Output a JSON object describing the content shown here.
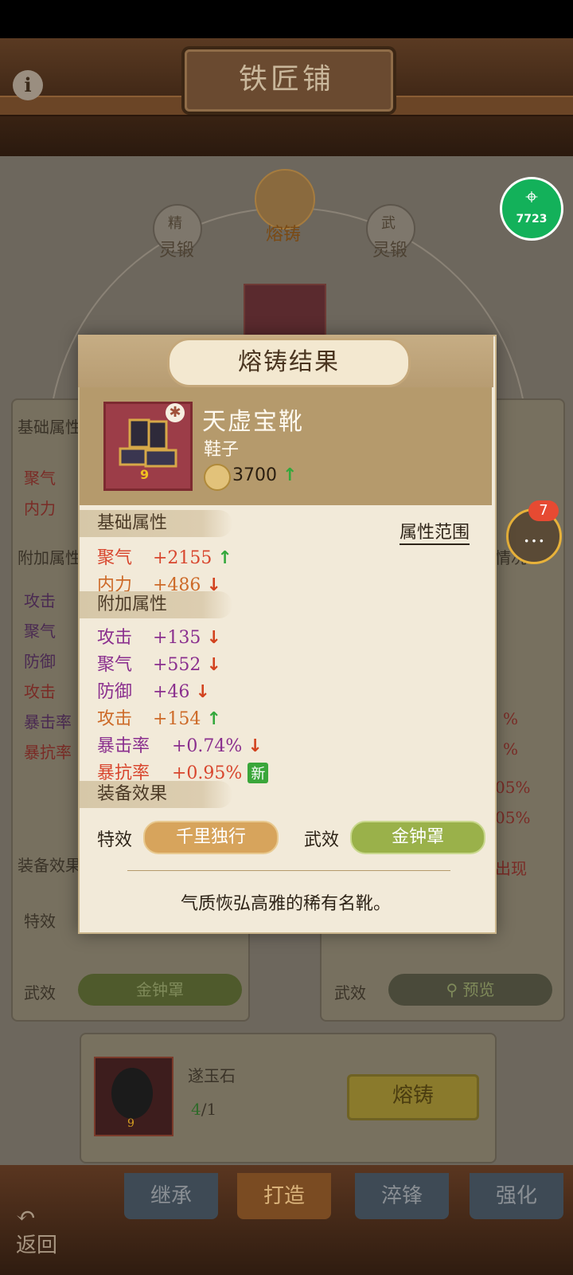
{
  "header": {
    "title": "铁匠铺",
    "info_icon": "i"
  },
  "modes": [
    {
      "label": "灵锻",
      "badge": "精"
    },
    {
      "label": "熔铸"
    },
    {
      "label": "灵锻",
      "badge": "武"
    }
  ],
  "assist_badge": "7723",
  "chat": {
    "badge": "7"
  },
  "background": {
    "left_panel": {
      "base_label": "基础属性",
      "base_rows": [
        "聚气",
        "内力"
      ],
      "extra_label": "附加属性",
      "extra_rows": [
        "攻击",
        "聚气",
        "防御",
        "攻击",
        "暴击率",
        "暴抗率"
      ],
      "effect_label": "装备效果",
      "special_label": "特效",
      "wu_label": "武效",
      "wu_value": "金钟罩"
    },
    "right_panel": {
      "percent_rows": [
        "%",
        "%",
        "05%",
        "05%"
      ],
      "side_text": "情况",
      "appear_text": "出现",
      "wu_label": "武效",
      "preview_label": "预览"
    },
    "material": {
      "name": "遂玉石",
      "count_have": "4",
      "count_need": "/1",
      "level": "9"
    },
    "forge_button": "熔铸"
  },
  "tabs": [
    "继承",
    "打造",
    "淬锋",
    "强化"
  ],
  "back_label": "返回",
  "dialog": {
    "title": "熔铸结果",
    "item": {
      "name": "天虚宝靴",
      "type": "鞋子",
      "level": "9",
      "power": "3700"
    },
    "base_section": "基础属性",
    "range_link": "属性范围",
    "base_attrs": [
      {
        "name": "聚气",
        "value": "+2155",
        "trend": "↑"
      },
      {
        "name": "内力",
        "value": "+486",
        "trend": "↓"
      }
    ],
    "extra_section": "附加属性",
    "extra_attrs": [
      {
        "name": "攻击",
        "value": "+135",
        "trend": "↓"
      },
      {
        "name": "聚气",
        "value": "+552",
        "trend": "↓"
      },
      {
        "name": "防御",
        "value": "+46",
        "trend": "↓"
      },
      {
        "name": "攻击",
        "value": "+154",
        "trend": "↑"
      },
      {
        "name": "暴击率",
        "value": "+0.74%",
        "trend": "↓"
      },
      {
        "name": "暴抗率",
        "value": "+0.95%",
        "tag": "新"
      }
    ],
    "effect_section": "装备效果",
    "special_label": "特效",
    "special_value": "千里独行",
    "wu_label": "武效",
    "wu_value": "金钟罩",
    "description": "气质恢弘高雅的稀有名靴。"
  }
}
